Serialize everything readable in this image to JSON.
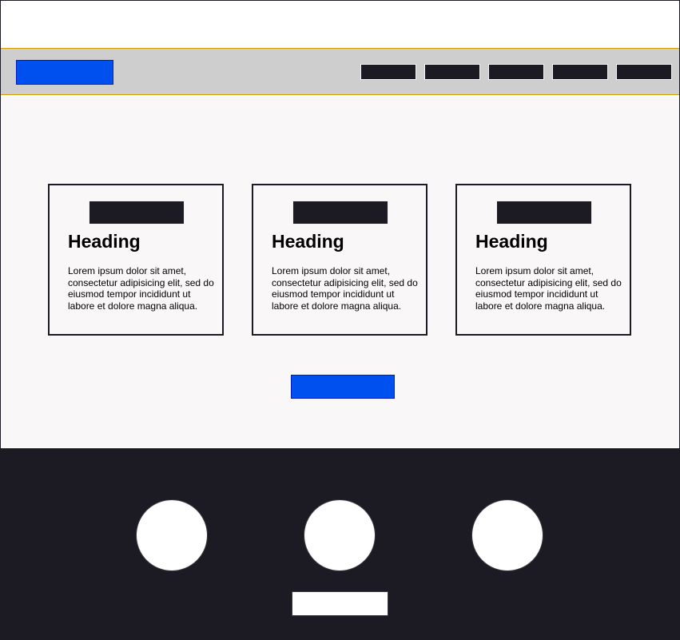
{
  "colors": {
    "accent": "#0050ef",
    "dark": "#1c1a22",
    "nav_background": "#cecece",
    "nav_border": "#d79b00",
    "main_background": "#f9f7f7"
  },
  "navbar": {
    "logo_icon": "logo-placeholder",
    "link_count_visible": 5
  },
  "cards": [
    {
      "heading": "Heading",
      "text": "Lorem ipsum dolor sit amet, consectetur adipisicing elit, sed do eiusmod tempor incididunt ut labore et dolore magna aliqua."
    },
    {
      "heading": "Heading",
      "text": "Lorem ipsum dolor sit amet, consectetur adipisicing elit, sed do eiusmod tempor incididunt ut labore et dolore magna aliqua."
    },
    {
      "heading": "Heading",
      "text": "Lorem ipsum dolor sit amet, consectetur adipisicing elit, sed do eiusmod tempor incididunt ut labore et dolore magna aliqua."
    }
  ]
}
